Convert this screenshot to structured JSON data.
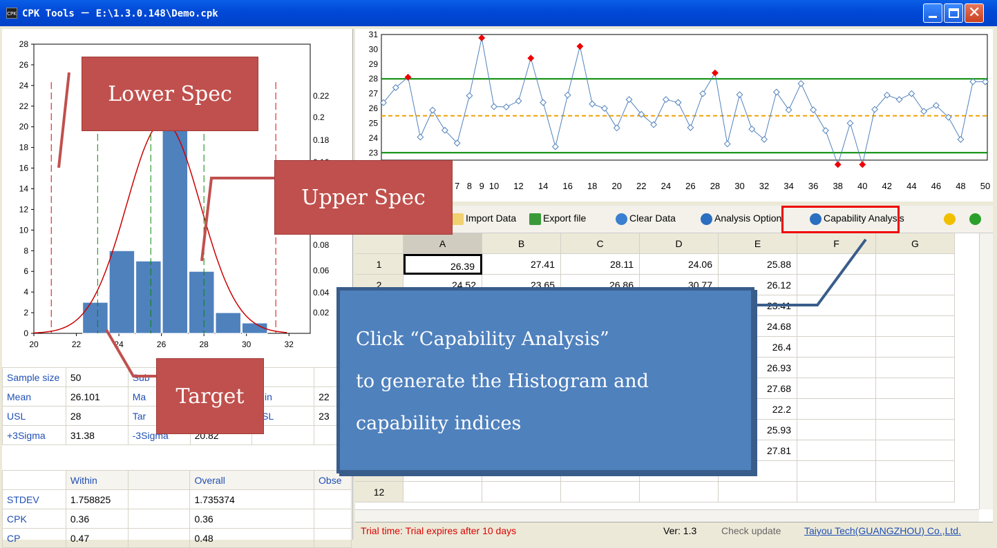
{
  "window": {
    "title": "CPK Tools － E:\\1.3.0.148\\Demo.cpk",
    "icon": "cpk-icon"
  },
  "histogram": {
    "y_ticks": [
      "0",
      "2",
      "4",
      "6",
      "8",
      "10",
      "12",
      "14",
      "16",
      "18",
      "20",
      "22",
      "24",
      "26",
      "28"
    ],
    "x_ticks": [
      "20",
      "22",
      "24",
      "26",
      "28",
      "30",
      "32"
    ],
    "right_ticks": [
      "0.22",
      "0.2",
      "0.18",
      "0.16",
      "0.08",
      "0.06",
      "0.04",
      "0.02"
    ],
    "bars": [
      {
        "x": 22.5,
        "h": 3
      },
      {
        "x": 23.75,
        "h": 8
      },
      {
        "x": 25,
        "h": 7
      },
      {
        "x": 26.25,
        "h": 21
      },
      {
        "x": 27.5,
        "h": 6
      },
      {
        "x": 28.75,
        "h": 2
      },
      {
        "x": 30,
        "h": 1
      }
    ],
    "lsl": 20.82,
    "usl": 31.38
  },
  "run_chart": {
    "y_ticks": [
      "23",
      "24",
      "25",
      "26",
      "27",
      "28",
      "29",
      "30",
      "31"
    ],
    "x_ticks": [
      "7",
      "8",
      "9",
      "10",
      "12",
      "14",
      "16",
      "18",
      "20",
      "22",
      "24",
      "26",
      "28",
      "30",
      "32",
      "34",
      "36",
      "38",
      "40",
      "42",
      "44",
      "46",
      "48",
      "50"
    ],
    "ucl": 28,
    "lcl": 23,
    "center": 25.5,
    "values": [
      26.39,
      27.41,
      28.11,
      24.06,
      25.88,
      24.52,
      23.65,
      26.86,
      30.77,
      26.12,
      26.1,
      26.5,
      29.4,
      26.4,
      23.41,
      26.9,
      30.2,
      26.3,
      26.0,
      24.68,
      26.6,
      25.6,
      24.9,
      26.6,
      26.4,
      24.7,
      27.0,
      28.4,
      23.6,
      26.93,
      24.6,
      23.9,
      27.1,
      25.9,
      27.68,
      25.9,
      24.5,
      22.2,
      25.0,
      22.2,
      25.93,
      26.9,
      26.6,
      27.0,
      25.8,
      26.2,
      25.4,
      23.9,
      27.81,
      27.8
    ]
  },
  "toolbar": {
    "import": "Import Data",
    "export": "Export file",
    "clear": "Clear Data",
    "option": "Analysis Option",
    "capability": "Capability Analysis"
  },
  "grid": {
    "cols": [
      "A",
      "B",
      "C",
      "D",
      "E",
      "F",
      "G"
    ],
    "rows": [
      [
        "1",
        "26.39",
        "27.41",
        "28.11",
        "24.06",
        "25.88"
      ],
      [
        "2",
        "24.52",
        "23.65",
        "26.86",
        "30.77",
        "26.12"
      ],
      [
        "3",
        "",
        "",
        "",
        "",
        "23.41"
      ],
      [
        "4",
        "",
        "",
        "",
        "",
        "24.68"
      ],
      [
        "5",
        "",
        "",
        "",
        "",
        "26.4"
      ],
      [
        "6",
        "",
        "",
        "",
        "",
        "26.93"
      ],
      [
        "7",
        "",
        "",
        "",
        "",
        "27.68"
      ],
      [
        "8",
        "",
        "",
        "",
        "",
        "22.2"
      ],
      [
        "9",
        "",
        "",
        "",
        "",
        "25.93"
      ],
      [
        "10",
        "",
        "",
        "",
        "",
        "27.81"
      ],
      [
        "11",
        "",
        "",
        "",
        "",
        ""
      ],
      [
        "12",
        "",
        "",
        "",
        "",
        ""
      ]
    ]
  },
  "stats1": [
    [
      "Sample size",
      "50",
      "Sub",
      "",
      "",
      ""
    ],
    [
      "Mean",
      "26.101",
      "Ma",
      "",
      "Min",
      "22"
    ],
    [
      "USL",
      "28",
      "Tar",
      "",
      "LSL",
      "23"
    ],
    [
      "+3Sigma",
      "31.38",
      "-3Sigma",
      "20.82",
      "",
      ""
    ]
  ],
  "stats2": [
    [
      "",
      "Within",
      "",
      "Overall",
      "Obse"
    ],
    [
      "STDEV",
      "1.758825",
      "",
      "1.735374",
      ""
    ],
    [
      "CPK",
      "0.36",
      "",
      "0.36",
      ""
    ],
    [
      "CP",
      "0.47",
      "",
      "0.48",
      ""
    ]
  ],
  "status": {
    "trial": "Trial time: Trial expires after 10 days",
    "ver": "Ver: 1.3",
    "check": "Check update",
    "company": "Taiyou Tech(GUANGZHOU) Co.,Ltd."
  },
  "callouts": {
    "lower": "Lower Spec",
    "upper": "Upper Spec",
    "target": "Target"
  },
  "blue": {
    "line1": "Click “Capability Analysis”",
    "line2": "to generate the Histogram and",
    "line3": "capability indices"
  }
}
